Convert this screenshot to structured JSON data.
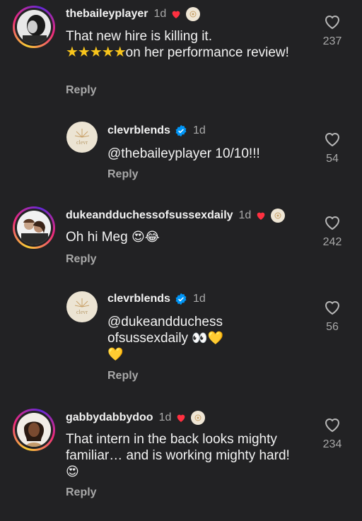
{
  "comments": [
    {
      "username": "thebaileyplayer",
      "time": "1d",
      "text_a": "That new hire is killing it.",
      "stars": "★★★★★",
      "text_b": "on her performance review!",
      "reply": "Reply",
      "likes": "237"
    },
    {
      "username": "clevrblends",
      "time": "1d",
      "text": "@thebaileyplayer 10/10!!!",
      "reply": "Reply",
      "likes": "54",
      "avatar_text": "clevr"
    },
    {
      "username": "dukeandduchessofsussexdaily",
      "time": "1d",
      "text": "Oh hi Meg",
      "emojis": "😍😂",
      "reply": "Reply",
      "likes": "242"
    },
    {
      "username": "clevrblends",
      "time": "1d",
      "text_a": "@dukeandduchess",
      "text_b": "ofsussexdaily",
      "emojis_b": "👀💛",
      "emojis_c": "💛",
      "reply": "Reply",
      "likes": "56",
      "avatar_text": "clevr"
    },
    {
      "username": "gabbydabbydoo",
      "time": "1d",
      "text": "That intern in the back looks mighty familiar… and is working mighty hard!",
      "emojis": "😍",
      "reply": "Reply",
      "likes": "234"
    }
  ],
  "colors": {
    "background": "#222224",
    "heart": "#ff3040",
    "verified": "#0095f6",
    "star": "#f8c51c"
  }
}
